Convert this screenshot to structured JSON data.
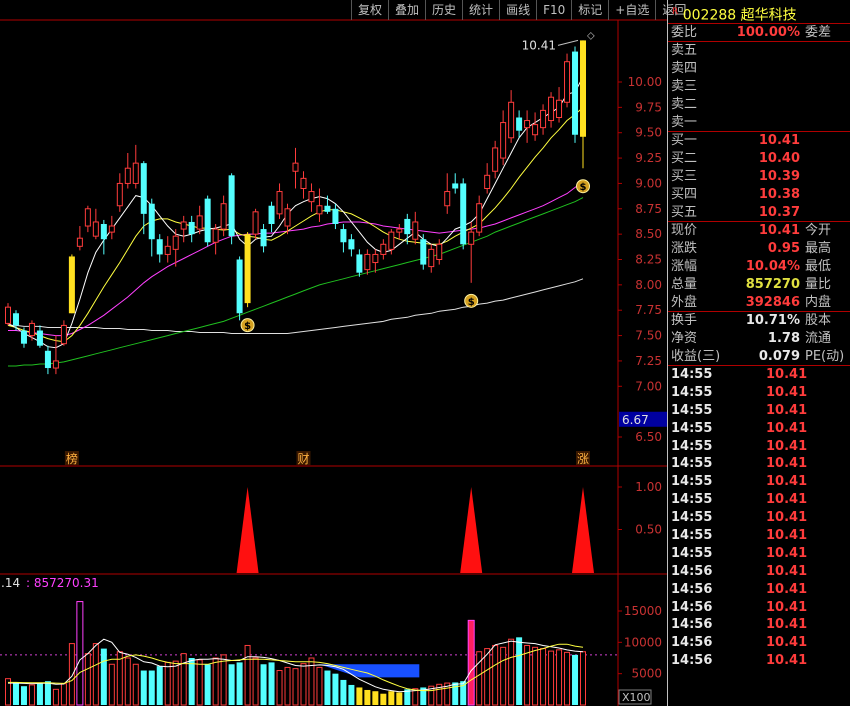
{
  "toolbar": {
    "buttons": [
      "复权",
      "叠加",
      "历史",
      "统计",
      "画线",
      "F10",
      "标记",
      "+自选",
      "返回"
    ]
  },
  "stock": {
    "code": "002288",
    "name": "超华科技",
    "badge": "R"
  },
  "quote": {
    "ratio_label": "委比",
    "ratio_value": "100.00%",
    "diff_label": "委差",
    "asks": [
      {
        "label": "卖五",
        "price": ""
      },
      {
        "label": "卖四",
        "price": ""
      },
      {
        "label": "卖三",
        "price": ""
      },
      {
        "label": "卖二",
        "price": ""
      },
      {
        "label": "卖一",
        "price": ""
      }
    ],
    "bids": [
      {
        "label": "买一",
        "price": "10.41"
      },
      {
        "label": "买二",
        "price": "10.40"
      },
      {
        "label": "买三",
        "price": "10.39"
      },
      {
        "label": "买四",
        "price": "10.38"
      },
      {
        "label": "买五",
        "price": "10.37"
      }
    ],
    "stats1": [
      {
        "label": "现价",
        "value": "10.41",
        "right": "今开"
      },
      {
        "label": "涨跌",
        "value": "0.95",
        "right": "最高"
      },
      {
        "label": "涨幅",
        "value": "10.04%",
        "right": "最低"
      },
      {
        "label": "总量",
        "value": "857270",
        "right": "量比"
      },
      {
        "label": "外盘",
        "value": "392846",
        "right": "内盘"
      }
    ],
    "stats2": [
      {
        "label": "换手",
        "value": "10.71%",
        "right": "股本"
      },
      {
        "label": "净资",
        "value": "1.78",
        "right": "流通"
      },
      {
        "label": "收益(三)",
        "value": "0.079",
        "right": "PE(动)"
      }
    ],
    "ticks": [
      {
        "time": "14:55",
        "price": "10.41"
      },
      {
        "time": "14:55",
        "price": "10.41"
      },
      {
        "time": "14:55",
        "price": "10.41"
      },
      {
        "time": "14:55",
        "price": "10.41"
      },
      {
        "time": "14:55",
        "price": "10.41"
      },
      {
        "time": "14:55",
        "price": "10.41"
      },
      {
        "time": "14:55",
        "price": "10.41"
      },
      {
        "time": "14:55",
        "price": "10.41"
      },
      {
        "time": "14:55",
        "price": "10.41"
      },
      {
        "time": "14:55",
        "price": "10.41"
      },
      {
        "time": "14:55",
        "price": "10.41"
      },
      {
        "time": "14:56",
        "price": "10.41"
      },
      {
        "time": "14:56",
        "price": "10.41"
      },
      {
        "time": "14:56",
        "price": "10.41"
      },
      {
        "time": "14:56",
        "price": "10.41"
      },
      {
        "time": "14:56",
        "price": "10.41"
      },
      {
        "time": "14:56",
        "price": "10.41"
      }
    ]
  },
  "price_axis": {
    "ticks": [
      "10.00",
      "9.75",
      "9.50",
      "9.25",
      "9.00",
      "8.75",
      "8.50",
      "8.25",
      "8.00",
      "7.75",
      "7.50",
      "7.25",
      "7.00",
      "6.50"
    ],
    "cursor_label": "6.67",
    "high_label": "10.41"
  },
  "event_marks": [
    {
      "label": "榜"
    },
    {
      "label": "财"
    },
    {
      "label": "涨"
    }
  ],
  "indicator_axis": {
    "ticks": [
      "1.00",
      "0.50"
    ]
  },
  "volume_panel": {
    "header_prefix": ".14",
    "header_value": ": 857270.31",
    "ticks": [
      "15000",
      "10000",
      "5000"
    ],
    "unit": "X100"
  },
  "colors": {
    "up": "#ff3c3c",
    "down": "#54ffff",
    "limit_up": "#ffe020",
    "ma5": "#ffffff",
    "ma10": "#ffff40",
    "ma20": "#ff40ff",
    "ma60": "#20c020",
    "ma120": "#e0e0e0"
  },
  "chart_data": {
    "type": "candlestick",
    "y_range": [
      6.35,
      10.55
    ],
    "candles": [
      [
        7.62,
        7.78,
        7.82,
        7.6,
        "up"
      ],
      [
        7.72,
        7.6,
        7.75,
        7.55,
        "down"
      ],
      [
        7.55,
        7.42,
        7.58,
        7.38,
        "down"
      ],
      [
        7.5,
        7.62,
        7.65,
        7.45,
        "up"
      ],
      [
        7.55,
        7.4,
        7.6,
        7.38,
        "down"
      ],
      [
        7.35,
        7.18,
        7.4,
        7.12,
        "down"
      ],
      [
        7.18,
        7.25,
        7.5,
        7.12,
        "up"
      ],
      [
        7.42,
        7.6,
        7.65,
        7.4,
        "up"
      ],
      [
        7.72,
        8.28,
        8.3,
        7.72,
        "limit"
      ],
      [
        8.38,
        8.46,
        8.58,
        8.34,
        "up"
      ],
      [
        8.58,
        8.75,
        8.78,
        8.52,
        "up"
      ],
      [
        8.48,
        8.62,
        8.75,
        8.45,
        "up"
      ],
      [
        8.6,
        8.45,
        8.64,
        8.3,
        "down"
      ],
      [
        8.52,
        8.58,
        8.68,
        8.45,
        "up"
      ],
      [
        8.78,
        9.0,
        9.1,
        8.72,
        "up"
      ],
      [
        9.0,
        9.15,
        9.3,
        8.95,
        "up"
      ],
      [
        9.0,
        9.2,
        9.38,
        8.95,
        "up"
      ],
      [
        9.2,
        8.7,
        9.22,
        8.5,
        "down"
      ],
      [
        8.8,
        8.45,
        8.85,
        8.28,
        "down"
      ],
      [
        8.45,
        8.3,
        8.5,
        8.22,
        "down"
      ],
      [
        8.3,
        8.38,
        8.48,
        8.22,
        "up"
      ],
      [
        8.35,
        8.48,
        8.55,
        8.18,
        "up"
      ],
      [
        8.55,
        8.62,
        8.68,
        8.42,
        "up"
      ],
      [
        8.62,
        8.5,
        8.68,
        8.42,
        "down"
      ],
      [
        8.55,
        8.68,
        8.78,
        8.5,
        "up"
      ],
      [
        8.85,
        8.42,
        8.88,
        8.38,
        "down"
      ],
      [
        8.42,
        8.55,
        8.6,
        8.3,
        "up"
      ],
      [
        8.55,
        8.8,
        8.88,
        8.48,
        "up"
      ],
      [
        9.08,
        8.48,
        9.1,
        8.4,
        "down"
      ],
      [
        8.25,
        7.72,
        8.28,
        7.65,
        "down"
      ],
      [
        7.82,
        8.5,
        8.52,
        7.78,
        "limit"
      ],
      [
        8.5,
        8.72,
        8.75,
        8.45,
        "up"
      ],
      [
        8.55,
        8.38,
        8.6,
        8.32,
        "down"
      ],
      [
        8.78,
        8.6,
        8.82,
        8.52,
        "down"
      ],
      [
        8.7,
        8.92,
        9.0,
        8.65,
        "up"
      ],
      [
        8.58,
        8.75,
        8.8,
        8.5,
        "up"
      ],
      [
        9.12,
        9.2,
        9.35,
        8.95,
        "up"
      ],
      [
        8.95,
        9.05,
        9.12,
        8.85,
        "up"
      ],
      [
        8.82,
        8.92,
        9.0,
        8.72,
        "up"
      ],
      [
        8.7,
        8.78,
        8.95,
        8.62,
        "up"
      ],
      [
        8.78,
        8.72,
        8.88,
        8.7,
        "down"
      ],
      [
        8.75,
        8.6,
        8.8,
        8.55,
        "down"
      ],
      [
        8.55,
        8.42,
        8.6,
        8.32,
        "down"
      ],
      [
        8.45,
        8.35,
        8.5,
        8.28,
        "down"
      ],
      [
        8.3,
        8.12,
        8.35,
        8.08,
        "down"
      ],
      [
        8.15,
        8.3,
        8.35,
        8.1,
        "up"
      ],
      [
        8.22,
        8.3,
        8.35,
        8.12,
        "up"
      ],
      [
        8.3,
        8.4,
        8.45,
        8.25,
        "up"
      ],
      [
        8.35,
        8.52,
        8.55,
        8.3,
        "up"
      ],
      [
        8.55,
        8.52,
        8.6,
        8.45,
        "up"
      ],
      [
        8.65,
        8.5,
        8.7,
        8.4,
        "down"
      ],
      [
        8.45,
        8.62,
        8.72,
        8.4,
        "up"
      ],
      [
        8.45,
        8.2,
        8.5,
        8.15,
        "down"
      ],
      [
        8.18,
        8.35,
        8.4,
        8.12,
        "up"
      ],
      [
        8.25,
        8.4,
        8.45,
        8.2,
        "up"
      ],
      [
        8.78,
        8.92,
        9.1,
        8.7,
        "up"
      ],
      [
        9.0,
        8.95,
        9.1,
        8.9,
        "down"
      ],
      [
        9.0,
        8.4,
        9.05,
        8.35,
        "down"
      ],
      [
        8.4,
        8.52,
        8.62,
        8.02,
        "up"
      ],
      [
        8.52,
        8.8,
        8.88,
        8.48,
        "up"
      ],
      [
        8.95,
        9.08,
        9.2,
        8.9,
        "up"
      ],
      [
        9.12,
        9.35,
        9.42,
        9.05,
        "up"
      ],
      [
        9.25,
        9.6,
        9.72,
        9.18,
        "up"
      ],
      [
        9.45,
        9.8,
        9.92,
        9.4,
        "up"
      ],
      [
        9.65,
        9.52,
        9.72,
        9.45,
        "down"
      ],
      [
        9.55,
        9.62,
        9.72,
        9.4,
        "up"
      ],
      [
        9.48,
        9.58,
        9.7,
        9.42,
        "up"
      ],
      [
        9.55,
        9.72,
        9.78,
        9.48,
        "up"
      ],
      [
        9.62,
        9.85,
        9.9,
        9.55,
        "up"
      ],
      [
        9.65,
        9.82,
        9.95,
        9.6,
        "up"
      ],
      [
        9.8,
        10.2,
        10.28,
        9.75,
        "up"
      ],
      [
        10.3,
        9.48,
        10.35,
        9.4,
        "down"
      ],
      [
        9.46,
        10.41,
        10.41,
        9.15,
        "limit"
      ]
    ],
    "ma5": [
      7.62,
      7.58,
      7.52,
      7.48,
      7.44,
      7.39,
      7.38,
      7.42,
      7.62,
      7.86,
      8.12,
      8.32,
      8.44,
      8.55,
      8.66,
      8.77,
      8.88,
      8.86,
      8.78,
      8.68,
      8.58,
      8.5,
      8.48,
      8.5,
      8.53,
      8.55,
      8.56,
      8.58,
      8.6,
      8.45,
      8.38,
      8.45,
      8.47,
      8.48,
      8.58,
      8.7,
      8.78,
      8.82,
      8.85,
      8.87,
      8.85,
      8.8,
      8.72,
      8.62,
      8.52,
      8.42,
      8.35,
      8.32,
      8.34,
      8.4,
      8.46,
      8.52,
      8.45,
      8.4,
      8.38,
      8.46,
      8.55,
      8.58,
      8.62,
      8.7,
      8.85,
      9.0,
      9.15,
      9.3,
      9.45,
      9.55,
      9.6,
      9.65,
      9.7,
      9.75,
      9.88,
      9.9,
      10.05
    ],
    "ma10": [
      7.6,
      7.58,
      7.55,
      7.53,
      7.5,
      7.47,
      7.45,
      7.44,
      7.5,
      7.6,
      7.72,
      7.85,
      7.98,
      8.1,
      8.22,
      8.35,
      8.48,
      8.58,
      8.63,
      8.65,
      8.65,
      8.62,
      8.6,
      8.58,
      8.56,
      8.56,
      8.55,
      8.54,
      8.55,
      8.5,
      8.48,
      8.47,
      8.45,
      8.44,
      8.48,
      8.53,
      8.58,
      8.63,
      8.68,
      8.72,
      8.74,
      8.74,
      8.72,
      8.7,
      8.66,
      8.62,
      8.57,
      8.52,
      8.48,
      8.45,
      8.43,
      8.42,
      8.41,
      8.4,
      8.4,
      8.43,
      8.48,
      8.52,
      8.56,
      8.6,
      8.68,
      8.76,
      8.85,
      8.95,
      9.06,
      9.16,
      9.26,
      9.35,
      9.45,
      9.53,
      9.62,
      9.68,
      9.75
    ],
    "ma20": [
      7.55,
      7.55,
      7.54,
      7.53,
      7.52,
      7.51,
      7.5,
      7.5,
      7.52,
      7.56,
      7.6,
      7.65,
      7.7,
      7.76,
      7.82,
      7.88,
      7.95,
      8.02,
      8.08,
      8.13,
      8.18,
      8.22,
      8.26,
      8.3,
      8.34,
      8.38,
      8.42,
      8.45,
      8.48,
      8.49,
      8.5,
      8.5,
      8.51,
      8.51,
      8.52,
      8.53,
      8.54,
      8.55,
      8.57,
      8.58,
      8.6,
      8.61,
      8.62,
      8.62,
      8.62,
      8.61,
      8.6,
      8.58,
      8.57,
      8.56,
      8.55,
      8.54,
      8.53,
      8.52,
      8.51,
      8.52,
      8.53,
      8.54,
      8.55,
      8.56,
      8.58,
      8.6,
      8.63,
      8.66,
      8.69,
      8.72,
      8.75,
      8.78,
      8.82,
      8.86,
      8.9,
      8.96,
      9.02
    ],
    "ma60": [
      7.2,
      7.2,
      7.21,
      7.21,
      7.22,
      7.22,
      7.23,
      7.24,
      7.26,
      7.28,
      7.3,
      7.32,
      7.34,
      7.36,
      7.38,
      7.4,
      7.42,
      7.44,
      7.46,
      7.48,
      7.5,
      7.52,
      7.54,
      7.56,
      7.58,
      7.6,
      7.62,
      7.64,
      7.67,
      7.7,
      7.73,
      7.76,
      7.79,
      7.82,
      7.85,
      7.88,
      7.91,
      7.94,
      7.97,
      8.0,
      8.02,
      8.04,
      8.06,
      8.08,
      8.1,
      8.12,
      8.14,
      8.16,
      8.18,
      8.2,
      8.22,
      8.24,
      8.26,
      8.28,
      8.3,
      8.33,
      8.36,
      8.39,
      8.42,
      8.45,
      8.48,
      8.52,
      8.55,
      8.58,
      8.61,
      8.64,
      8.67,
      8.7,
      8.73,
      8.76,
      8.79,
      8.82,
      8.86
    ],
    "ma120": [
      7.6,
      7.6,
      7.59,
      7.59,
      7.59,
      7.58,
      7.58,
      7.58,
      7.58,
      7.58,
      7.58,
      7.58,
      7.57,
      7.57,
      7.57,
      7.56,
      7.56,
      7.56,
      7.55,
      7.55,
      7.55,
      7.54,
      7.54,
      7.54,
      7.53,
      7.53,
      7.53,
      7.53,
      7.52,
      7.52,
      7.52,
      7.52,
      7.52,
      7.52,
      7.52,
      7.52,
      7.53,
      7.54,
      7.55,
      7.56,
      7.57,
      7.58,
      7.59,
      7.6,
      7.61,
      7.62,
      7.63,
      7.64,
      7.66,
      7.67,
      7.68,
      7.7,
      7.71,
      7.72,
      7.74,
      7.75,
      7.76,
      7.78,
      7.79,
      7.81,
      7.82,
      7.84,
      7.85,
      7.87,
      7.89,
      7.91,
      7.93,
      7.95,
      7.97,
      7.99,
      8.01,
      8.03,
      8.06
    ],
    "events": [
      {
        "index": 8,
        "label": "榜"
      },
      {
        "index": 37,
        "label": "财"
      },
      {
        "index": 72,
        "label": "涨"
      }
    ],
    "signal_markers": [
      30,
      58,
      72
    ],
    "indicator": {
      "y_range": [
        0,
        1.1
      ],
      "spikes": [
        30,
        58,
        72
      ]
    },
    "volume": {
      "y_range": [
        0,
        18500
      ],
      "values": [
        4200,
        3600,
        3000,
        3200,
        3500,
        3800,
        2500,
        3400,
        9800,
        16500,
        8200,
        9800,
        9000,
        6500,
        8500,
        7500,
        6500,
        5500,
        5500,
        6200,
        6800,
        7000,
        8200,
        7500,
        7200,
        6500,
        7500,
        8000,
        6500,
        6800,
        9500,
        7500,
        6500,
        6800,
        5500,
        6000,
        5800,
        6600,
        7500,
        6000,
        5500,
        5000,
        4000,
        3200,
        2800,
        2400,
        2200,
        1800,
        2200,
        2000,
        2500,
        2600,
        2800,
        3000,
        3300,
        3500,
        3600,
        3800,
        13500,
        8500,
        9000,
        9500,
        9200,
        10500,
        10800,
        9500,
        9200,
        9000,
        8600,
        8800,
        8400,
        8000,
        8500
      ],
      "shrink_highlight": [
        44,
        45,
        46,
        47,
        48,
        49
      ],
      "ma5": [
        3500,
        3500,
        3450,
        3400,
        3450,
        3500,
        3300,
        3350,
        4600,
        7200,
        8200,
        9500,
        10500,
        10000,
        8400,
        8100,
        7600,
        6900,
        6700,
        6200,
        6100,
        6200,
        6700,
        7100,
        7300,
        7300,
        7400,
        7300,
        7100,
        7100,
        7700,
        7700,
        7600,
        7400,
        7100,
        6700,
        6300,
        6200,
        6300,
        6400,
        6300,
        6100,
        5700,
        4900,
        4100,
        3500,
        2900,
        2500,
        2300,
        2100,
        2200,
        2300,
        2400,
        2600,
        2800,
        3000,
        3300,
        3400,
        5500,
        6800,
        8100,
        9600,
        9900,
        10200,
        10000,
        9900,
        9800,
        9500,
        9300,
        9100,
        8800,
        8600,
        8500
      ],
      "ma10": [
        3600,
        3600,
        3580,
        3550,
        3550,
        3550,
        3500,
        3450,
        3900,
        5200,
        5800,
        6400,
        7000,
        7300,
        7300,
        7800,
        8000,
        7800,
        7500,
        7100,
        6800,
        6600,
        6600,
        6600,
        6500,
        6500,
        6800,
        7000,
        7100,
        7200,
        7300,
        7300,
        7300,
        7200,
        7100,
        7000,
        6900,
        6900,
        6900,
        6800,
        6600,
        6300,
        6000,
        5700,
        5400,
        5100,
        4600,
        4000,
        3500,
        3000,
        2600,
        2400,
        2300,
        2300,
        2500,
        2700,
        2900,
        3100,
        4000,
        4800,
        5600,
        6400,
        7100,
        7600,
        7900,
        8300,
        8700,
        9000,
        9400,
        9700,
        9700,
        9400,
        9200
      ]
    }
  }
}
